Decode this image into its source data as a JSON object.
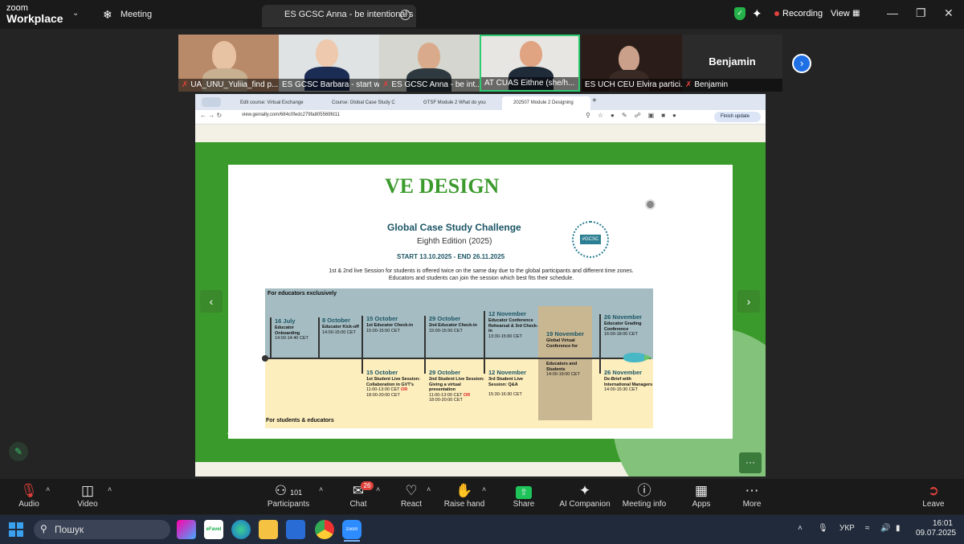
{
  "app": {
    "logo_line1": "zoom",
    "logo_line2": "Workplace",
    "meeting_label": "Meeting",
    "active_tab_title": "ES GCSC Anna - be intentional's s",
    "recording": "Recording",
    "view": "View"
  },
  "participants": [
    {
      "name": "UA_UNU_Yuliia_find p..."
    },
    {
      "name": "ES GCSC Barbara - start w..."
    },
    {
      "name": "ES GCSC Anna - be int..."
    },
    {
      "name": "AT CUAS Eithne (she/h..."
    },
    {
      "name": "ES UCH CEU Elvira partici..."
    },
    {
      "name": "Benjamin",
      "big_label": "Benjamin"
    }
  ],
  "browser": {
    "tabs": [
      "Edit course: Virtual Exchange",
      "Course: Global Case Study C",
      "GTSF Module 2 What do you",
      "202507 Module 2 Designing"
    ],
    "url": "view.genially.com/684c0fedc279fa805569fd11",
    "finish_update": "Finish update"
  },
  "slide": {
    "title": "VE DESIGN",
    "subtitle": "Global Case Study Challenge",
    "edition": "Eighth Edition (2025)",
    "dates": "START 13.10.2025 -  END 26.11.2025",
    "note_line1": "1st & 2nd live Session for students is offered twice on the same day due to the global participants and different time zones.",
    "note_line2": "Educators and students can join the session which best fits their schedule.",
    "logo_text": "#GCSC",
    "section_top": "For educators exclusively",
    "section_bottom": "For students & educators",
    "top_events": [
      {
        "date": "16 July",
        "title": "Educator Onboarding",
        "time": "14:00-14:40 CET"
      },
      {
        "date": "8 October",
        "title": "Educator Kick-off",
        "time": "14:00-15:00 CET"
      },
      {
        "date": "15 October",
        "title": "1st Educator Check-in",
        "time": "15:00-15:50 CET"
      },
      {
        "date": "29 October",
        "title": "2nd Educator Check-in",
        "time": "15:00-15:50 CET"
      },
      {
        "date": "12 November",
        "title": "Educator Conference Rehearsal & 3rd Check-in",
        "time": "13:30-15:00 CET"
      },
      {
        "date": "26 November",
        "title": "Educator Grading Conference",
        "time": "16:00-18:00 CET"
      }
    ],
    "middle_event": {
      "date": "19 November",
      "title": "Global Virtual Conference for",
      "title2": "Educators and Students",
      "time": "14:00-19:00 CET"
    },
    "bottom_events": [
      {
        "date": "15 October",
        "title": "1st Student Live Session: Collaboration in GVT's",
        "time1": "11:00-13:00 CET",
        "or": "OR",
        "time2": "18:00-20:00 CET"
      },
      {
        "date": "29 October",
        "title": "2nd Student Live Session: Giving a virtual presentation",
        "time1": "11:00-13:00 CET",
        "or": "OR",
        "time2": "18:00-20:00 CET"
      },
      {
        "date": "12 November",
        "title": "3rd Student Live Session: Q&A",
        "time1": "15:30-16:30 CET"
      },
      {
        "date": "26 November",
        "title": "De-Brief with International Managers",
        "time1": "14:00-15:30 CET"
      }
    ]
  },
  "toolbar": {
    "audio": "Audio",
    "video": "Video",
    "participants": "Participants",
    "participants_count": "101",
    "chat": "Chat",
    "chat_badge": "26",
    "react": "React",
    "raise_hand": "Raise hand",
    "share": "Share",
    "ai_companion": "AI Companion",
    "meeting_info": "Meeting info",
    "apps": "Apps",
    "more": "More",
    "leave": "Leave"
  },
  "taskbar": {
    "search_placeholder": "Пошук",
    "lang": "УКР",
    "time": "16:01",
    "date": "09.07.2025",
    "efavel": "eFavel"
  },
  "colors": {
    "zoom_dark": "#1a1a1a",
    "slide_green": "#3a9a2b",
    "timeline_top": "#a4bcc2",
    "timeline_bottom": "#fdeebe",
    "conference": "#c9b792",
    "active_speaker": "#2ecc71",
    "share_green": "#1ec45a"
  }
}
